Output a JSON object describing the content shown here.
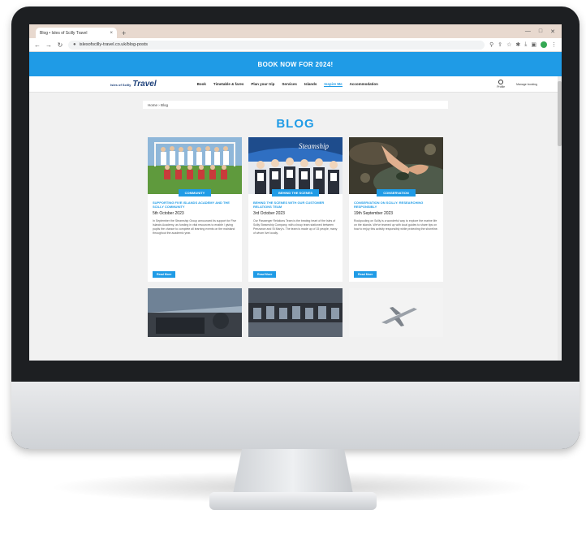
{
  "browser": {
    "tab_title": "Blog • Isles of Scilly Travel",
    "close_glyph": "×",
    "new_tab_glyph": "+",
    "url": "islesofscilly-travel.co.uk/blog-posts",
    "window_controls": [
      "—",
      "□",
      "✕"
    ]
  },
  "banner": {
    "text": "BOOK NOW FOR 2024!"
  },
  "nav": {
    "logo_small": "Isles of Scilly",
    "logo_main": "Travel",
    "links": [
      "Book",
      "Timetable & fares",
      "Plan your trip",
      "Services",
      "Islands",
      "Inspire Me",
      "Accommodation"
    ],
    "active_index": 5,
    "util": [
      "Profile",
      "Manage booking"
    ]
  },
  "breadcrumb": "Home › Blog",
  "page_title": "BLOG",
  "cards": [
    {
      "tag": "COMMUNITY",
      "headline": "SUPPORTING FIVE ISLANDS ACADEMY AND THE SCILLY COMMUNITY",
      "date": "5th October 2023",
      "excerpt": "In September the Steamship Group announced its support for Five Islands Academy, as funding in vital resources to enable / giving pupils the chance to complete all learning events on the mainland throughout the academic year.",
      "read_more": "Read More"
    },
    {
      "tag": "BEHIND THE SCENES",
      "headline": "BEHIND THE SCENES WITH OUR CUSTOMER RELATIONS TEAM",
      "date": "3rd October 2023",
      "excerpt": "Our Passenger Relations Team is the beating heart of the Isles of Scilly Steamship Company, with a busy team stationed between Penzance and St Mary's. The team is made up of 15 people, many of whom live locally.",
      "read_more": "Read More"
    },
    {
      "tag": "CONSERVATION",
      "headline": "CONSERVATION ON SCILLY: RESEARCHING RESPONSIBLY",
      "date": "19th September 2023",
      "excerpt": "Rockpooling on Scilly is a wonderful way to explore the marine life on the islands. We've teamed up with local guides to share tips on how to enjoy this activity responsibly while protecting the shoreline.",
      "read_more": "Read More"
    }
  ]
}
